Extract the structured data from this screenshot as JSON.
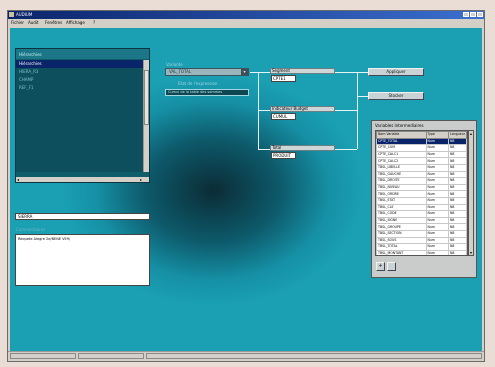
{
  "window": {
    "title": "AUDIUM"
  },
  "menu": [
    "Fichier",
    "Audit",
    "Fenêtres",
    "Affichage",
    "?"
  ],
  "left_panel": {
    "title": "Hiérarchies",
    "items": [
      "Hiérarchies",
      "HIERA_R3",
      "CHAMP",
      "REF_F1"
    ],
    "selected_index": 0,
    "field_value": "SIERRA",
    "notes_label": "Commentaires",
    "notes_text": "Requete Alegre 2e/BENE VE9/"
  },
  "combo": {
    "label": "Variante",
    "value": "VAL_TOTAL",
    "label2": "Etat de l'expression",
    "value2": "Cumul de la table des sommes"
  },
  "nodes": [
    {
      "title": "Segment",
      "value": "CPTE1"
    },
    {
      "title": "Indicateur Budget",
      "value": "CUMUL"
    },
    {
      "title": "Total",
      "value": "PRODUIT"
    }
  ],
  "buttons": {
    "execute": "Appliquer",
    "save": "Stocker"
  },
  "variables_panel": {
    "title": "Variables Intermediaires",
    "columns": [
      "Nom Variable",
      "Type",
      "Longueur"
    ],
    "rows": [
      [
        "CPTE_TOTAL",
        "Num",
        "N8"
      ],
      [
        "CPTE_CUM",
        "Num",
        "N8"
      ],
      [
        "CPTE_CALC1",
        "Num",
        "N8"
      ],
      [
        "CPTE_CALC2",
        "Num",
        "N8"
      ],
      [
        "TBSL_LIBELLE",
        "Num",
        "N8"
      ],
      [
        "TBSL_GAUCHE",
        "Num",
        "N8"
      ],
      [
        "TBSL_DROITE",
        "Num",
        "N8"
      ],
      [
        "TBSL_NIVEAU",
        "Num",
        "N8"
      ],
      [
        "TBSL_ORDRE",
        "Num",
        "N8"
      ],
      [
        "TBSL_ETAT",
        "Num",
        "N8"
      ],
      [
        "TBSL_CLE",
        "Num",
        "N8"
      ],
      [
        "TBSL_CODE",
        "Num",
        "N8"
      ],
      [
        "TBSL_SIGNE",
        "Num",
        "N8"
      ],
      [
        "TBSL_GROUPE",
        "Num",
        "N8"
      ],
      [
        "TBSL_SECTION",
        "Num",
        "N8"
      ],
      [
        "TBSL_SOUS",
        "Num",
        "N8"
      ],
      [
        "TBSL_TOTAL",
        "Num",
        "N8"
      ],
      [
        "TBSL_MONTANT",
        "Num",
        "N8"
      ],
      [
        "TBSL_ECART",
        "Num",
        "N8"
      ]
    ],
    "selected_row": 0,
    "add_button": "+"
  },
  "colors": {
    "accent": "#0a246a",
    "background_center": "#0b2c36",
    "background_edge": "#1a9fb3"
  }
}
